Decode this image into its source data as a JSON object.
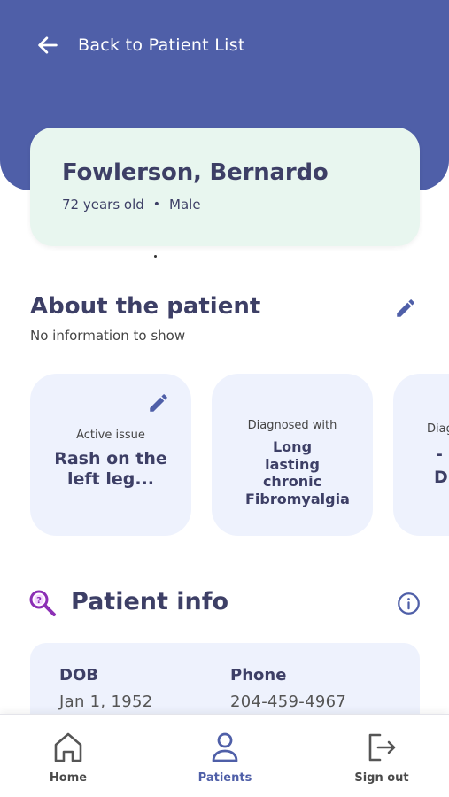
{
  "header": {
    "back_label": "Back to Patient List",
    "background_color": "#4f5fa8"
  },
  "patient": {
    "name": "Fowlerson, Bernardo",
    "age": "72 years old",
    "separator": "•",
    "sex": "Male"
  },
  "about": {
    "title": "About the patient",
    "subtitle": "No information to show"
  },
  "tiles": [
    {
      "caption": "Active issue",
      "value": "Rash on the left leg..."
    },
    {
      "caption": "Diagnosed with",
      "value": "Long lasting chronic Fibromyalgia"
    },
    {
      "caption": "Diag",
      "value_line1": "-",
      "value_line2": "D"
    }
  ],
  "patient_info": {
    "title": "Patient info",
    "fields": {
      "dob_label": "DOB",
      "dob_value": "Jan 1, 1952",
      "phone_label": "Phone",
      "phone_value": "204-459-4967"
    }
  },
  "nav": {
    "home": "Home",
    "patients": "Patients",
    "signout": "Sign out",
    "active": "Patients"
  },
  "icons": {
    "back": "arrow-left-icon",
    "edit": "pencil-icon",
    "search": "magnifier-icon",
    "info": "info-circle-icon",
    "home": "home-icon",
    "patients": "person-icon",
    "signout": "logout-icon"
  },
  "colors": {
    "primary": "#4f5fa8",
    "card_green": "#e8f6ef",
    "card_blue": "#eef2fd",
    "text_dark": "#3d3f66",
    "accent_purple": "#8c2fb5"
  }
}
